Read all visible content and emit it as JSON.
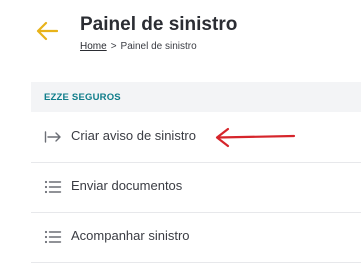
{
  "header": {
    "title": "Painel de sinistro",
    "back_icon": "arrow-left-icon",
    "accent_color": "#e8b31a"
  },
  "breadcrumb": {
    "home": "Home",
    "separator": ">",
    "current": "Painel de sinistro"
  },
  "menu": {
    "section_title": "EZZE SEGUROS",
    "section_color": "#0f7d8a",
    "items": [
      {
        "label": "Criar aviso de sinistro",
        "icon": "arrow-into-icon"
      },
      {
        "label": "Enviar documentos",
        "icon": "list-icon"
      },
      {
        "label": "Acompanhar sinistro",
        "icon": "list-icon"
      }
    ]
  },
  "annotation": {
    "icon": "red-arrow-pointer-icon",
    "color": "#d6252b"
  }
}
